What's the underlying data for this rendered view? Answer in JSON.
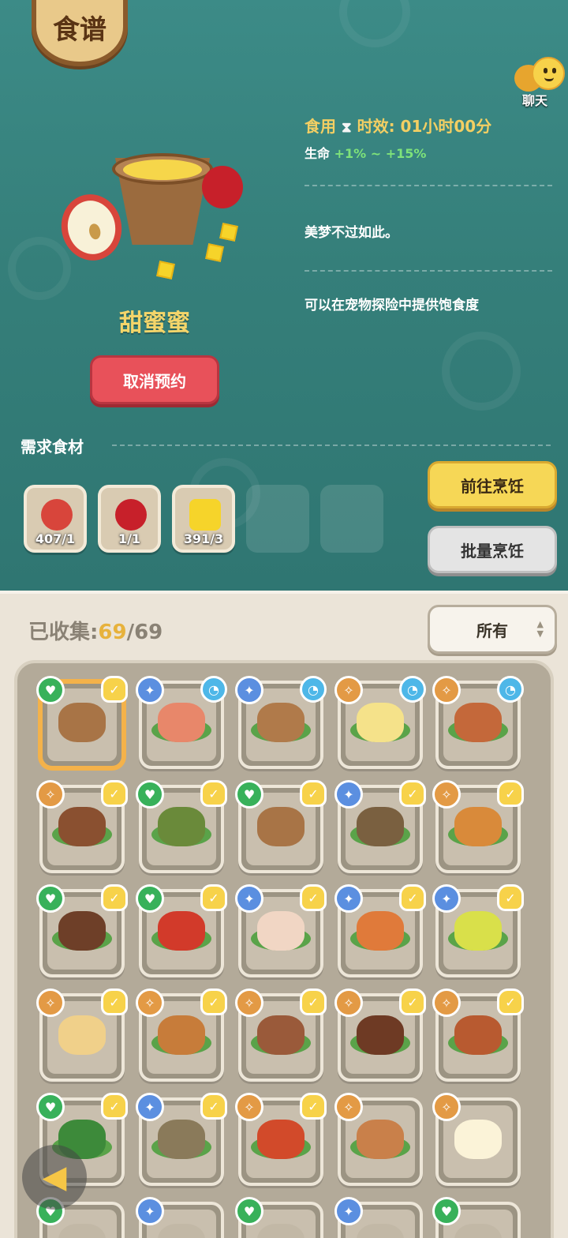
{
  "header": {
    "title": "食谱",
    "chat_label": "聊天"
  },
  "dish": {
    "name": "甜蜜蜜",
    "cancel_label": "取消预约",
    "duration_prefix": "食用",
    "duration_label": "时效:",
    "duration_value": "01小时00分",
    "stat_name": "生命",
    "stat_range_low": "+1%",
    "stat_range_sep": "~",
    "stat_range_high": "+15%",
    "flavor_text": "美梦不过如此。",
    "description": "可以在宠物探险中提供饱食度"
  },
  "ingredients": {
    "label": "需求食材",
    "items": [
      {
        "icon": "apple-icon",
        "count": "407/1",
        "color": "#d8453b"
      },
      {
        "icon": "pomegranate-icon",
        "count": "1/1",
        "color": "#c7202a"
      },
      {
        "icon": "honeycomb-icon",
        "count": "391/3",
        "color": "#f6d42a"
      },
      {
        "icon": "",
        "count": ""
      },
      {
        "icon": "",
        "count": ""
      }
    ]
  },
  "actions": {
    "go_cook": "前往烹饪",
    "batch_cook": "批量烹饪"
  },
  "collection": {
    "label": "已收集:",
    "collected": "69",
    "total": "/69",
    "filter_value": "所有"
  },
  "colors": {
    "accent_gold": "#f3cf63",
    "stat_green": "#7ee27a",
    "cancel_red": "#e8515a",
    "go_cook_yellow": "#f6d756"
  },
  "recipes": [
    {
      "badge": "heart",
      "status": "hat",
      "food": "honey-bucket",
      "selected": true
    },
    {
      "badge": "blue",
      "status": "clock",
      "food": "salmon-plate"
    },
    {
      "badge": "blue",
      "status": "clock",
      "food": "stew-plate"
    },
    {
      "badge": "orange",
      "status": "clock",
      "food": "egg-plate"
    },
    {
      "badge": "orange",
      "status": "clock",
      "food": "roast-plate"
    },
    {
      "badge": "orange",
      "status": "hat",
      "food": "mushroom-skewer"
    },
    {
      "badge": "heart",
      "status": "hat",
      "food": "veggie-skewer"
    },
    {
      "badge": "heart",
      "status": "hat",
      "food": "honey-bucket"
    },
    {
      "badge": "blue",
      "status": "hat",
      "food": "fish-skewer"
    },
    {
      "badge": "orange",
      "status": "hat",
      "food": "roast-leg"
    },
    {
      "badge": "heart",
      "status": "hat",
      "food": "mushroom-kebab"
    },
    {
      "badge": "heart",
      "status": "hat",
      "food": "chili-skewer"
    },
    {
      "badge": "blue",
      "status": "hat",
      "food": "scallop-plate"
    },
    {
      "badge": "blue",
      "status": "hat",
      "food": "shrimp-skewer"
    },
    {
      "badge": "blue",
      "status": "hat",
      "food": "grape-leaf"
    },
    {
      "badge": "orange",
      "status": "hat",
      "food": "pizza"
    },
    {
      "badge": "orange",
      "status": "hat",
      "food": "stir-fry"
    },
    {
      "badge": "orange",
      "status": "hat",
      "food": "meat-plate"
    },
    {
      "badge": "orange",
      "status": "hat",
      "food": "meat-skewer"
    },
    {
      "badge": "orange",
      "status": "hat",
      "food": "sausage-skewer"
    },
    {
      "badge": "heart",
      "status": "hat",
      "food": "salad"
    },
    {
      "badge": "blue",
      "status": "hat",
      "food": "fish-plate"
    },
    {
      "badge": "orange",
      "status": "hat",
      "food": "crab-plate"
    },
    {
      "badge": "orange",
      "status": "",
      "food": "ham"
    },
    {
      "badge": "orange",
      "status": "",
      "food": "fried-egg"
    },
    {
      "badge": "heart",
      "status": "",
      "food": "partial"
    },
    {
      "badge": "blue",
      "status": "",
      "food": "partial"
    },
    {
      "badge": "heart",
      "status": "",
      "food": "partial"
    },
    {
      "badge": "blue",
      "status": "",
      "food": "partial"
    },
    {
      "badge": "heart",
      "status": "",
      "food": "partial"
    }
  ]
}
